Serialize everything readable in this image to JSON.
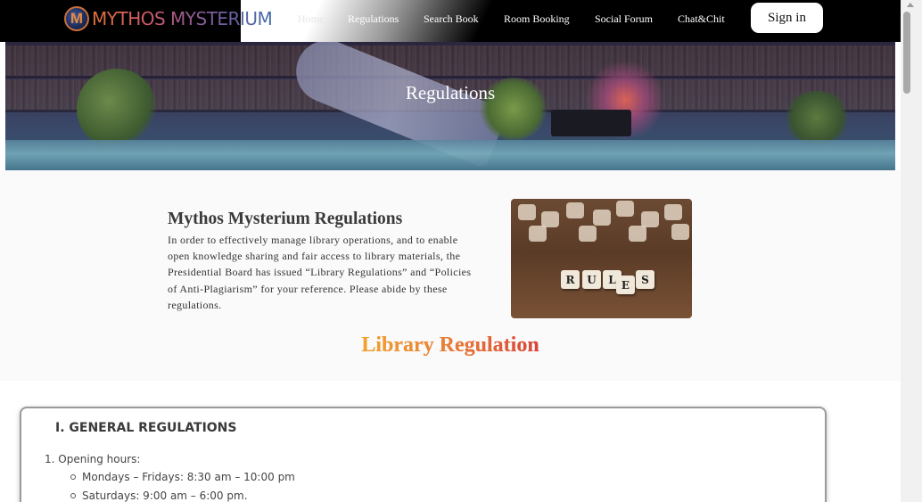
{
  "brand": {
    "name": "MYTHOS MYSTERIUM"
  },
  "nav": {
    "items": [
      {
        "label": "Home"
      },
      {
        "label": "Regulations"
      },
      {
        "label": "Search Book"
      },
      {
        "label": "Room Booking"
      },
      {
        "label": "Social Forum"
      },
      {
        "label": "Chat&Chit"
      }
    ],
    "signin_label": "Sign in"
  },
  "banner": {
    "title": "Regulations"
  },
  "intro": {
    "title": "Mythos Mysterium Regulations",
    "lines": [
      "In order to effectively manage library operations, and to enable",
      "open knowledge sharing and fair access to library materials, the",
      "Presidential Board has issued “Library Regulations” and “Policies",
      "of Anti-Plagiarism” for your reference. Please abide by these",
      "regulations."
    ],
    "image_letters": [
      "R",
      "U",
      "L",
      "E",
      "S"
    ]
  },
  "library_title": "Library Regulation",
  "regulation": {
    "heading": "I. GENERAL REGULATIONS",
    "item1": "1. Opening hours:",
    "hours": [
      "Mondays – Fridays: 8:30 am – 10:00 pm",
      "Saturdays: 9:00 am – 6:00 pm."
    ]
  },
  "colors": {
    "navbar": "#000000",
    "title_gradient_start": "#f2a22c",
    "title_gradient_end": "#d9433a"
  }
}
